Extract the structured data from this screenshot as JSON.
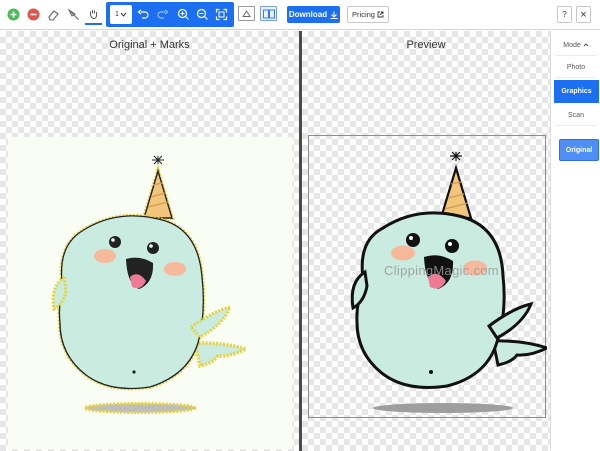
{
  "toolbar": {
    "icons": [
      "plus-circle-icon",
      "minus-circle-icon",
      "eraser-icon",
      "scalpel-icon",
      "hand-icon",
      "brush-size-select",
      "undo-icon",
      "redo-icon",
      "zoom-in-icon",
      "zoom-out-icon",
      "fit-icon",
      "single-view-icon",
      "split-view-icon"
    ],
    "brush_select_value": "1",
    "download_label": "Download",
    "pricing_label": "Pricing",
    "help_label": "?",
    "close_label": "×",
    "colors": {
      "accent": "#1d6ff2",
      "keep_green": "#4cb95b",
      "remove_red": "#e2544c"
    }
  },
  "left_pane": {
    "title": "Original + Marks"
  },
  "right_pane": {
    "title": "Preview",
    "watermark": "ClippingMagic.com"
  },
  "sidebar": {
    "mode_label": "Mode",
    "photo_label": "Photo",
    "graphics_label": "Graphics",
    "scan_label": "Scan",
    "original_label": "Original",
    "selected": "Graphics"
  }
}
